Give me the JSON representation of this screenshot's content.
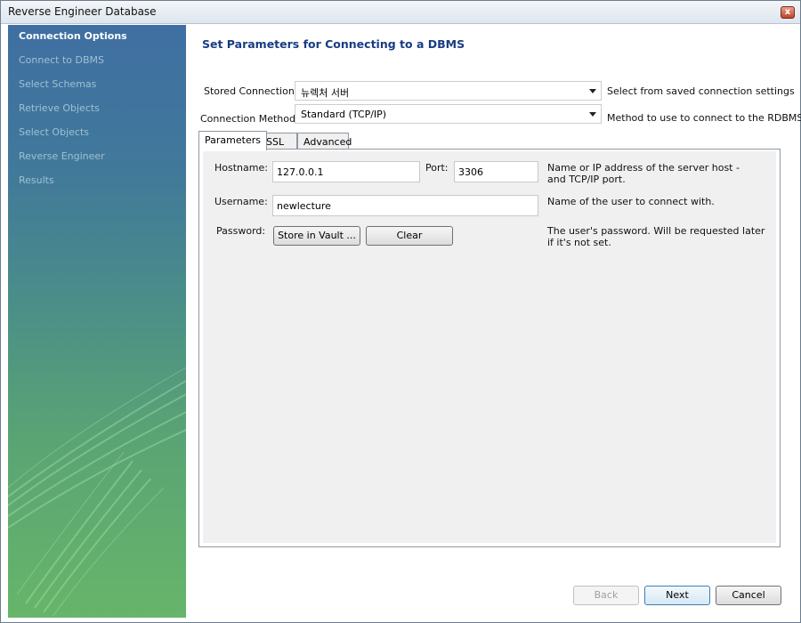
{
  "window": {
    "title": "Reverse Engineer Database",
    "close_glyph": "x"
  },
  "sidebar": {
    "steps": [
      {
        "label": "Connection Options",
        "active": true
      },
      {
        "label": "Connect to DBMS"
      },
      {
        "label": "Select Schemas"
      },
      {
        "label": "Retrieve Objects"
      },
      {
        "label": "Select Objects"
      },
      {
        "label": "Reverse Engineer"
      },
      {
        "label": "Results"
      }
    ]
  },
  "main": {
    "title": "Set Parameters for Connecting to a DBMS",
    "stored_connection": {
      "label": "Stored Connection:",
      "value": "뉴렉처 서버",
      "hint": "Select from saved connection settings"
    },
    "connection_method": {
      "label": "Connection Method:",
      "value": "Standard (TCP/IP)",
      "hint": "Method to use to connect to the RDBMS"
    },
    "tabs": [
      {
        "label": "Parameters",
        "active": true
      },
      {
        "label": "SSL"
      },
      {
        "label": "Advanced"
      }
    ],
    "parameters": {
      "hostname_label": "Hostname:",
      "hostname_value": "127.0.0.1",
      "port_label": "Port:",
      "port_value": "3306",
      "hostname_hint": "Name or IP address of the server host - and TCP/IP port.",
      "username_label": "Username:",
      "username_value": "newlecture",
      "username_hint": "Name of the user to connect with.",
      "password_label": "Password:",
      "store_vault_label": "Store in Vault ...",
      "clear_label": "Clear",
      "password_hint": "The user's password. Will be requested later if it's not set."
    }
  },
  "footer": {
    "back_label": "Back",
    "next_label": "Next",
    "cancel_label": "Cancel"
  }
}
